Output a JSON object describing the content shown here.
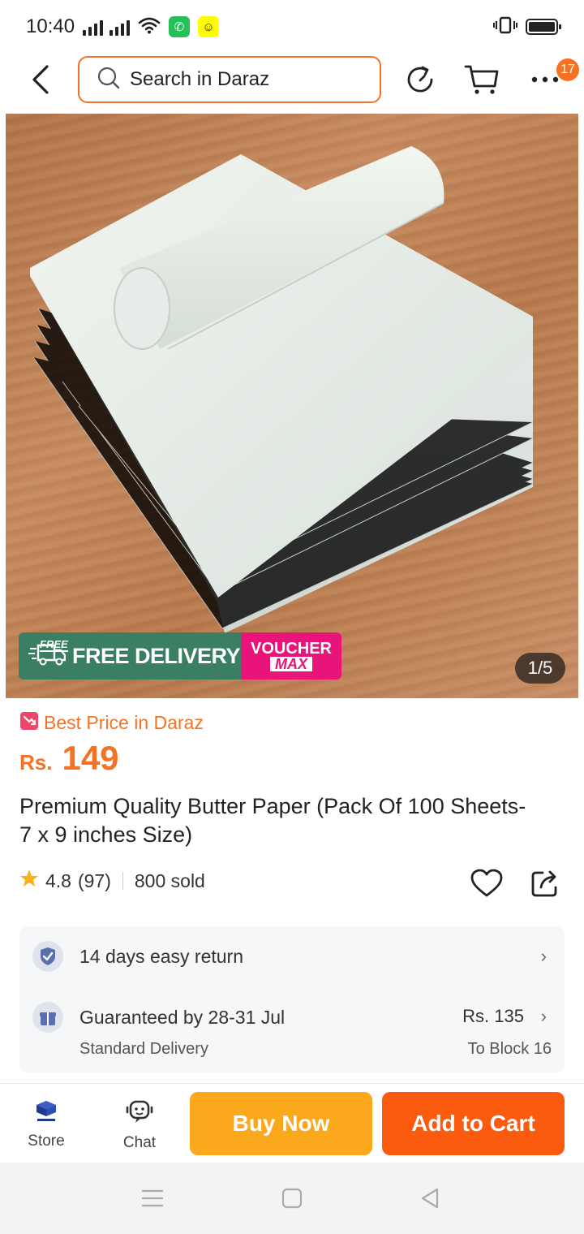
{
  "status_bar": {
    "time": "10:40",
    "icons": [
      "signal-icon",
      "signal-icon",
      "wifi-icon",
      "whatsapp-icon",
      "snapchat-icon",
      "vibrate-icon",
      "battery-icon"
    ]
  },
  "header": {
    "search": {
      "placeholder": "Search in Daraz"
    },
    "cart_badge_count": "17",
    "icons": [
      "back-arrow-icon",
      "search-icon",
      "history-icon",
      "cart-icon",
      "more-icon"
    ]
  },
  "product_image": {
    "promo_free_tag": "FREE",
    "promo_main": "FREE DELIVERY",
    "promo_voucher_top": "VOUCHER",
    "promo_voucher_bottom": "MAX",
    "counter": "1/5"
  },
  "price_section": {
    "best_price_label": "Best Price in Daraz",
    "currency": "Rs.",
    "price": "149"
  },
  "product": {
    "title": "Premium Quality Butter Paper (Pack Of 100 Sheets- 7 x 9 inches Size)",
    "rating": "4.8",
    "reviews": "(97)",
    "sold": "800 sold"
  },
  "info": {
    "return_text": "14 days easy return",
    "delivery_text": "Guaranteed by 28-31 Jul",
    "delivery_type": "Standard Delivery",
    "shipping_price": "Rs. 135",
    "ship_to": "To Block 16"
  },
  "bottom_bar": {
    "store_label": "Store",
    "chat_label": "Chat",
    "buy_now": "Buy Now",
    "add_to_cart": "Add to Cart"
  },
  "colors": {
    "accent": "#f57224",
    "buy_now": "#fba81d",
    "add_to_cart": "#fa5b0f",
    "promo_green": "#3a7f63",
    "promo_pink": "#e8147a"
  }
}
